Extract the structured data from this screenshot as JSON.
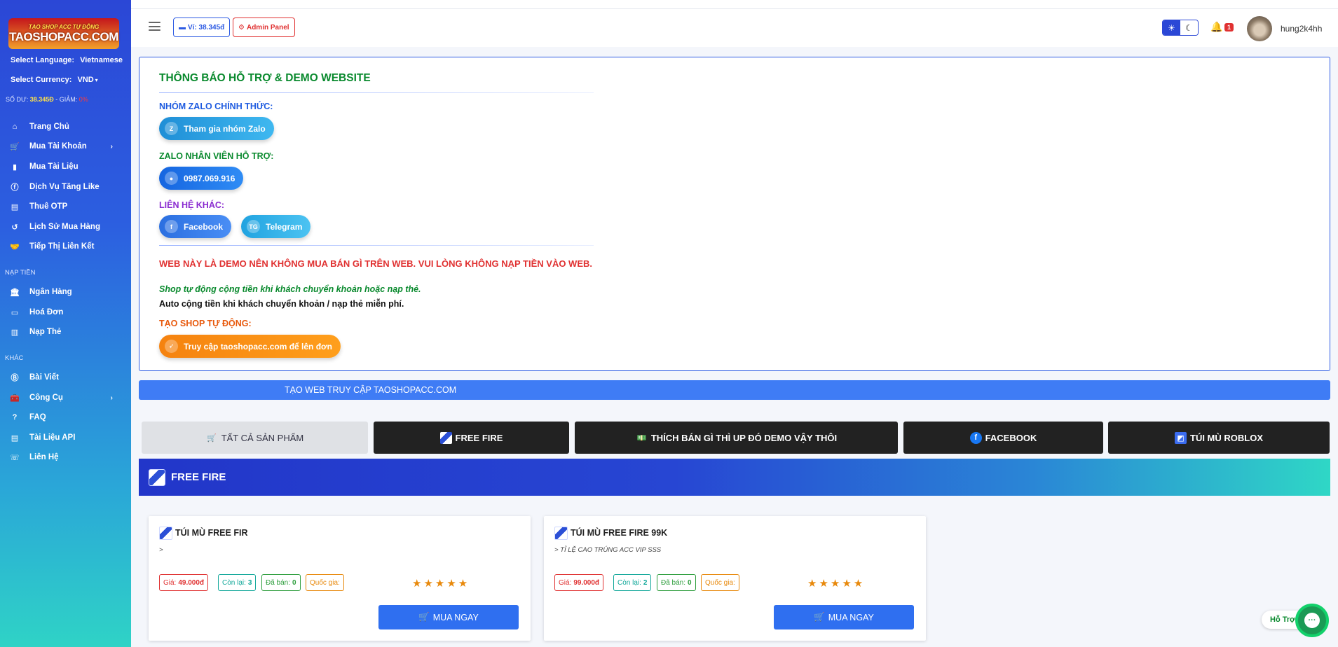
{
  "sidebar": {
    "logo_line1": "TẠO SHOP ACC TỰ ĐỘNG",
    "logo_line2": "TAOSHOPACC.COM",
    "language_label": "Select Language:",
    "language_value": "Vietnamese",
    "currency_label": "Select Currency:",
    "currency_value": "VND",
    "balance_label": "SỐ DƯ:",
    "balance_value": "38.345Đ",
    "discount_label": "- GIẢM:",
    "discount_value": "0%",
    "nav_main": [
      {
        "label": "Trang Chủ",
        "icon": "home-icon"
      },
      {
        "label": "Mua Tài Khoản",
        "icon": "cart-icon"
      },
      {
        "label": "Mua Tài Liệu",
        "icon": "book-icon"
      },
      {
        "label": "Dịch Vụ Tăng Like",
        "icon": "facebook-icon"
      },
      {
        "label": "Thuê OTP",
        "icon": "file-icon"
      },
      {
        "label": "Lịch Sử Mua Hàng",
        "icon": "history-icon"
      },
      {
        "label": "Tiếp Thị Liên Kết",
        "icon": "handshake-icon"
      }
    ],
    "section_topup": "NẠP TIỀN",
    "nav_topup": [
      {
        "label": "Ngân Hàng",
        "icon": "bank-icon"
      },
      {
        "label": "Hoá Đơn",
        "icon": "invoice-icon"
      },
      {
        "label": "Nạp Thẻ",
        "icon": "card-icon"
      }
    ],
    "section_other": "KHÁC",
    "nav_other": [
      {
        "label": "Bài Viết",
        "icon": "blog-icon"
      },
      {
        "label": "Công Cụ",
        "icon": "toolbox-icon"
      },
      {
        "label": "FAQ",
        "icon": "question-icon"
      },
      {
        "label": "Tài Liệu API",
        "icon": "document-icon"
      },
      {
        "label": "Liên Hệ",
        "icon": "contact-icon"
      }
    ]
  },
  "topbar": {
    "wallet_label": "Ví: 38.345đ",
    "admin_label": "Admin Panel",
    "notification_count": "1",
    "username": "hung2k4hh"
  },
  "notice": {
    "title": "THÔNG BÁO HỖ TRỢ & DEMO WEBSITE",
    "zalo_group_label": "NHÓM ZALO CHÍNH THỨC:",
    "zalo_group_button": "Tham gia nhóm Zalo",
    "zalo_staff_label": "ZALO NHÂN VIÊN HỖ TRỢ:",
    "zalo_staff_phone": "0987.069.916",
    "other_contact_label": "LIÊN HỆ KHÁC:",
    "facebook_button": "Facebook",
    "telegram_button": "Telegram",
    "warning": "WEB NÀY LÀ DEMO NÊN KHÔNG MUA BÁN GÌ TRÊN WEB. VUI LÒNG KHÔNG NẠP TIỀN VÀO WEB.",
    "auto_line1": "Shop tự động cộng tiền khi khách chuyển khoản hoặc nạp thẻ.",
    "auto_line2": "Auto cộng tiền khi khách chuyển khoản / nạp thẻ miễn phí.",
    "create_shop_label": "TẠO SHOP TỰ ĐỘNG:",
    "create_shop_button": "Truy cập taoshopacc.com để lên đơn"
  },
  "banner_text": "TẠO WEB TRUY CẬP TAOSHOPACC.COM",
  "tabs": [
    {
      "label": "TẤT CẢ SẢN PHẨM",
      "icon": "cart-icon"
    },
    {
      "label": "FREE FIRE",
      "icon": "freefire-icon"
    },
    {
      "label": "THÍCH BÁN GÌ THÌ UP ĐÓ DEMO VẬY THÔI",
      "icon": "money-icon"
    },
    {
      "label": "FACEBOOK",
      "icon": "facebook-icon"
    },
    {
      "label": "TÚI MÙ ROBLOX",
      "icon": "roblox-icon"
    }
  ],
  "category_title": "FREE FIRE",
  "products": [
    {
      "name": "TÚI MÙ FREE FIR",
      "desc": ">",
      "price_label": "Giá:",
      "price": "49.000đ",
      "left_label": "Còn lại:",
      "left": "3",
      "sold_label": "Đã bán:",
      "sold": "0",
      "country_label": "Quốc gia:",
      "rating": 5,
      "buy_label": "MUA NGAY"
    },
    {
      "name": "TÚI MÙ FREE FIRE 99K",
      "desc": "> TỈ LỆ CAO TRÚNG ACC VIP SSS",
      "price_label": "Giá:",
      "price": "99.000đ",
      "left_label": "Còn lại:",
      "left": "2",
      "sold_label": "Đã bán:",
      "sold": "0",
      "country_label": "Quốc gia:",
      "rating": 5,
      "buy_label": "MUA NGAY"
    }
  ],
  "support_label": "Hỗ Trợ",
  "colors": {
    "primary": "#2f6ff0",
    "accent_green": "#0a8a2e",
    "danger": "#e03131",
    "orange": "#e8890c"
  }
}
